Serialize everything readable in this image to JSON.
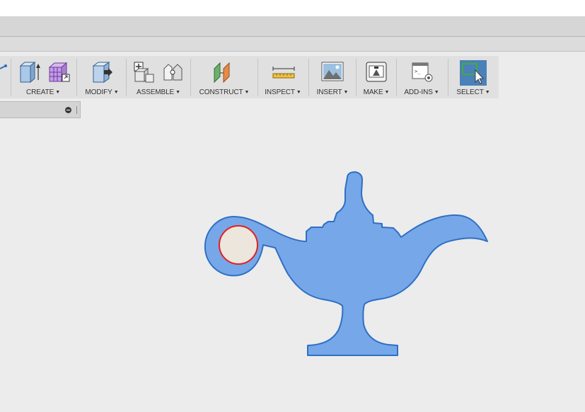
{
  "toolbar": {
    "groups": [
      {
        "label": "CREATE",
        "icons": [
          "extrude-box-icon",
          "form-cube-icon"
        ]
      },
      {
        "label": "MODIFY",
        "icons": [
          "press-pull-icon"
        ]
      },
      {
        "label": "ASSEMBLE",
        "icons": [
          "new-component-icon",
          "joint-icon"
        ]
      },
      {
        "label": "CONSTRUCT",
        "icons": [
          "offset-plane-icon"
        ]
      },
      {
        "label": "INSPECT",
        "icons": [
          "measure-ruler-icon"
        ]
      },
      {
        "label": "INSERT",
        "icons": [
          "insert-image-icon"
        ]
      },
      {
        "label": "MAKE",
        "icons": [
          "3d-print-icon"
        ]
      },
      {
        "label": "ADD-INS",
        "icons": [
          "scripts-addins-icon"
        ]
      },
      {
        "label": "SELECT",
        "icons": [
          "select-window-icon"
        ]
      }
    ]
  },
  "colors": {
    "sketch_fill": "#76a7e8",
    "sketch_outline": "#2f6fc4",
    "selected_circle_stroke": "#e02020",
    "selected_circle_fill": "#ede6dd",
    "select_active_bg": "#4b80b8"
  }
}
